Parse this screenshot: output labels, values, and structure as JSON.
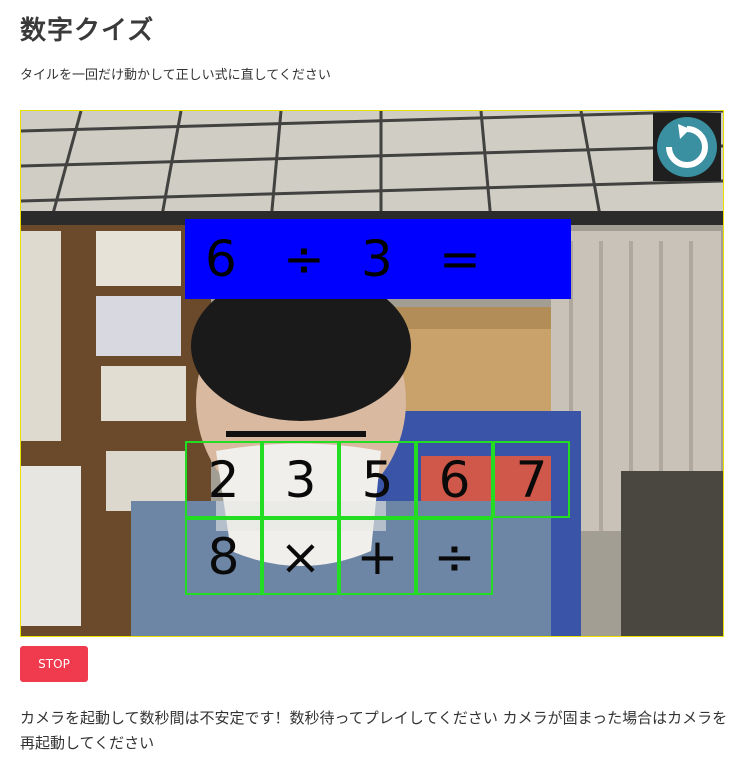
{
  "page": {
    "title": "数字クイズ",
    "instruction": "タイルを一回だけ動かして正しい式に直してください",
    "note": "カメラを起動して数秒間は不安定です！数秒待ってプレイしてください カメラが固まった場合はカメラを再起動してください"
  },
  "game": {
    "reset_icon": "rotate-ccw-icon",
    "equation": [
      "6",
      "÷",
      "3",
      "="
    ],
    "tiles_row1": [
      "2",
      "3",
      "5",
      "6",
      "7"
    ],
    "tiles_row2": [
      "8",
      "×",
      "+",
      "÷"
    ]
  },
  "controls": {
    "stop_label": "STOP"
  },
  "colors": {
    "equation_bg": "#0000ff",
    "tile_border": "#22dd22",
    "camera_border": "#e8e000",
    "stop_bg": "#f03a4e",
    "reset_icon": "#3a8fa0"
  }
}
